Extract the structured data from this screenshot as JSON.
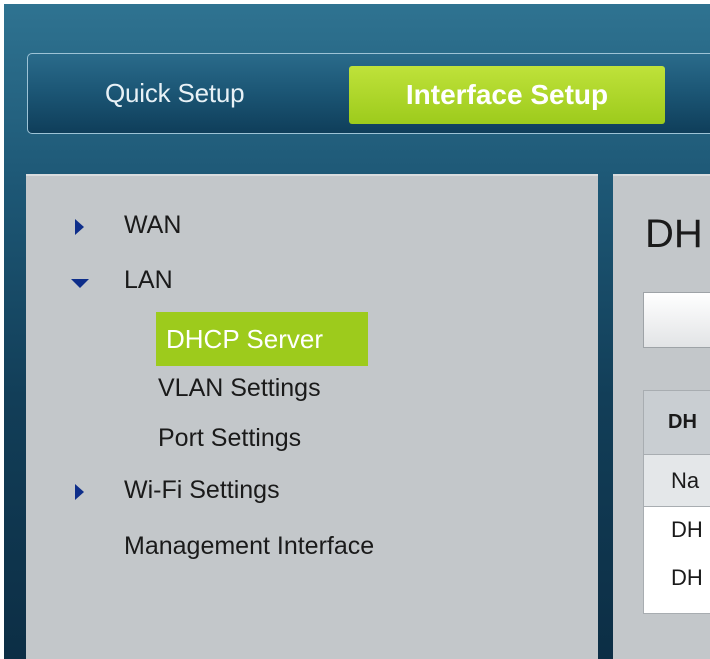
{
  "tabs": {
    "quick_setup": "Quick Setup",
    "interface_setup": "Interface Setup"
  },
  "sidebar": {
    "items": [
      {
        "label": "WAN",
        "icon": "caret-right-icon",
        "state": "collapsed"
      },
      {
        "label": "LAN",
        "icon": "caret-down-icon",
        "state": "expanded"
      },
      {
        "label": "DHCP Server",
        "selected": true
      },
      {
        "label": "VLAN Settings"
      },
      {
        "label": "Port Settings"
      },
      {
        "label": "Wi-Fi Settings",
        "icon": "caret-right-icon",
        "state": "collapsed"
      },
      {
        "label": "Management Interface"
      }
    ]
  },
  "main": {
    "title": "DH",
    "table": {
      "header": "DH",
      "rows": [
        "Na",
        "DH",
        "DH"
      ]
    }
  },
  "colors": {
    "accent_green": "#9dcb1c",
    "header_blue": "#1b5574",
    "sidebar_gray": "#c3c7ca",
    "caret_blue": "#0e2e8a"
  }
}
